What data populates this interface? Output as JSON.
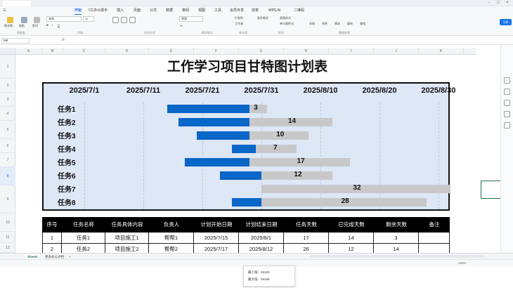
{
  "window": {
    "tabs": [
      "",
      "",
      "",
      "",
      ""
    ],
    "controls": [
      "-",
      "□",
      "×"
    ]
  },
  "menu": {
    "file_label": "三",
    "items": [
      "开始",
      "CC办公助手",
      "插入",
      "页面",
      "公式",
      "数据",
      "审阅",
      "视图",
      "工具",
      "会员专享",
      "效率",
      "WPS AI",
      "二维码"
    ],
    "active": "开始"
  },
  "ribbon": {
    "left_buttons": [
      "格式刷",
      "粘贴",
      "剪切"
    ],
    "font_name": "宋体",
    "font_size": "11",
    "groups": [
      "剪贴板",
      "字体",
      "对齐方式",
      "数字格式",
      "单元格",
      "样式",
      "数据处理"
    ],
    "number_format": "常规",
    "cells_items": [
      "行和列",
      "工作表",
      "单元格"
    ],
    "style_items": [
      "条件格式",
      "表格样式",
      "单元格样式"
    ],
    "data_items": [
      "求和",
      "排序",
      "筛选",
      "填充",
      "查找"
    ],
    "share_label": "分享"
  },
  "formula": {
    "cell_ref": "M8",
    "fx": "fx"
  },
  "sheet": {
    "columns": [
      "A",
      "B",
      "C",
      "D",
      "E",
      "F",
      "G",
      "H",
      "I",
      "J",
      "K"
    ],
    "rows": [
      "1",
      "2",
      "3",
      "4",
      "5",
      "6",
      "7",
      "8",
      "9",
      "10",
      "11",
      "12"
    ],
    "title": "工作学习项目甘特图计划表"
  },
  "chart_data": {
    "type": "bar",
    "title": "",
    "dates": [
      "2025/7/1",
      "2025/7/11",
      "2025/7/21",
      "2025/7/31",
      "2025/8/10",
      "2025/8/20",
      "2025/8/30"
    ],
    "categories": [
      "任务1",
      "任务2",
      "任务3",
      "任务4",
      "任务5",
      "任务6",
      "任务7",
      "任务8"
    ],
    "series": [
      {
        "name": "",
        "color": "#0a66c7",
        "start": [
          "2025/7/15",
          "2025/7/17",
          "2025/7/20",
          "2025/7/26",
          "2025/7/18",
          "2025/7/24",
          "2025/7/31",
          "2025/7/26"
        ],
        "values": [
          14,
          12,
          9,
          4,
          11,
          7,
          0,
          5
        ]
      },
      {
        "name": "",
        "color": "#c8c8c8",
        "values": [
          3,
          14,
          10,
          7,
          17,
          12,
          32,
          28
        ]
      }
    ],
    "labels": [
      "3",
      "14",
      "10",
      "7",
      "17",
      "12",
      "32",
      "28"
    ],
    "xlim": [
      "2025/7/1",
      "2025/8/30"
    ]
  },
  "table": {
    "headers": [
      "序号",
      "任务名称",
      "任务具体内容",
      "负责人",
      "计划开始日期",
      "计划结束日期",
      "任务天数",
      "已完成天数",
      "剩余天数",
      "备注"
    ],
    "rows": [
      [
        "1",
        "任务1",
        "项目施工1",
        "帮帮1",
        "2025/7/15",
        "2025/8/1",
        "17",
        "14",
        "3",
        ""
      ],
      [
        "2",
        "任务2",
        "项目施工2",
        "帮帮2",
        "2025/7/17",
        "2025/8/12",
        "26",
        "12",
        "14",
        ""
      ]
    ]
  },
  "sheets": {
    "tabs": [
      "Sheet1",
      "更多办公文档"
    ],
    "active": "Sheet1",
    "add": "+"
  },
  "status": {
    "min_label": "最小值：45120",
    "max_label": "最大值：45166",
    "zoom": "100%"
  }
}
